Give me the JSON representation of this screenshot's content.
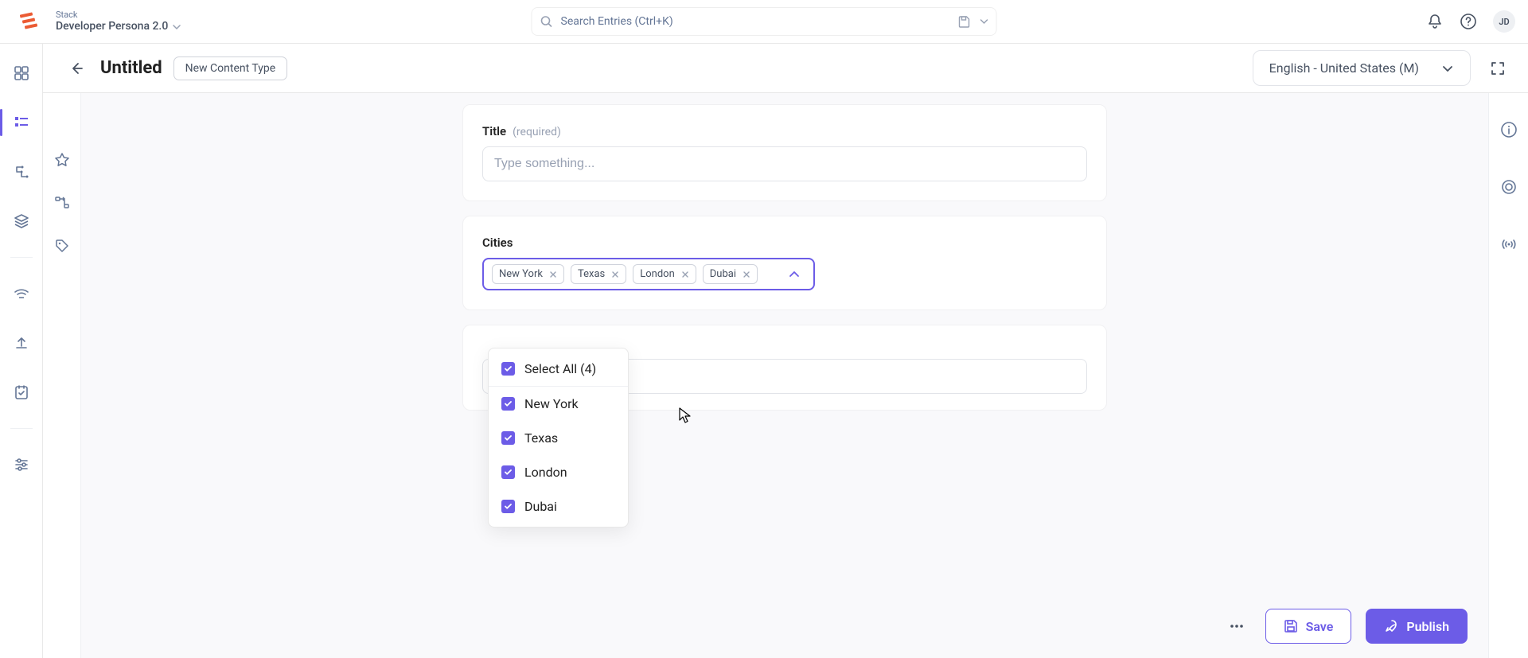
{
  "header": {
    "stack_label": "Stack",
    "stack_name": "Developer Persona 2.0",
    "search_placeholder": "Search Entries (Ctrl+K)",
    "avatar_initials": "JD"
  },
  "subheader": {
    "title": "Untitled",
    "badge": "New Content Type",
    "locale": "English - United States (M)"
  },
  "fields": {
    "title": {
      "label": "Title",
      "required_text": "(required)",
      "placeholder": "Type something..."
    },
    "cities": {
      "label": "Cities",
      "chips": [
        "New York",
        "Texas",
        "London",
        "Dubai"
      ],
      "select_all_label": "Select All (4)",
      "options": [
        {
          "label": "New York",
          "checked": true
        },
        {
          "label": "Texas",
          "checked": true
        },
        {
          "label": "London",
          "checked": true
        },
        {
          "label": "Dubai",
          "checked": true
        }
      ]
    }
  },
  "footer": {
    "save_label": "Save",
    "publish_label": "Publish"
  },
  "colors": {
    "accent": "#6c5ce7"
  }
}
